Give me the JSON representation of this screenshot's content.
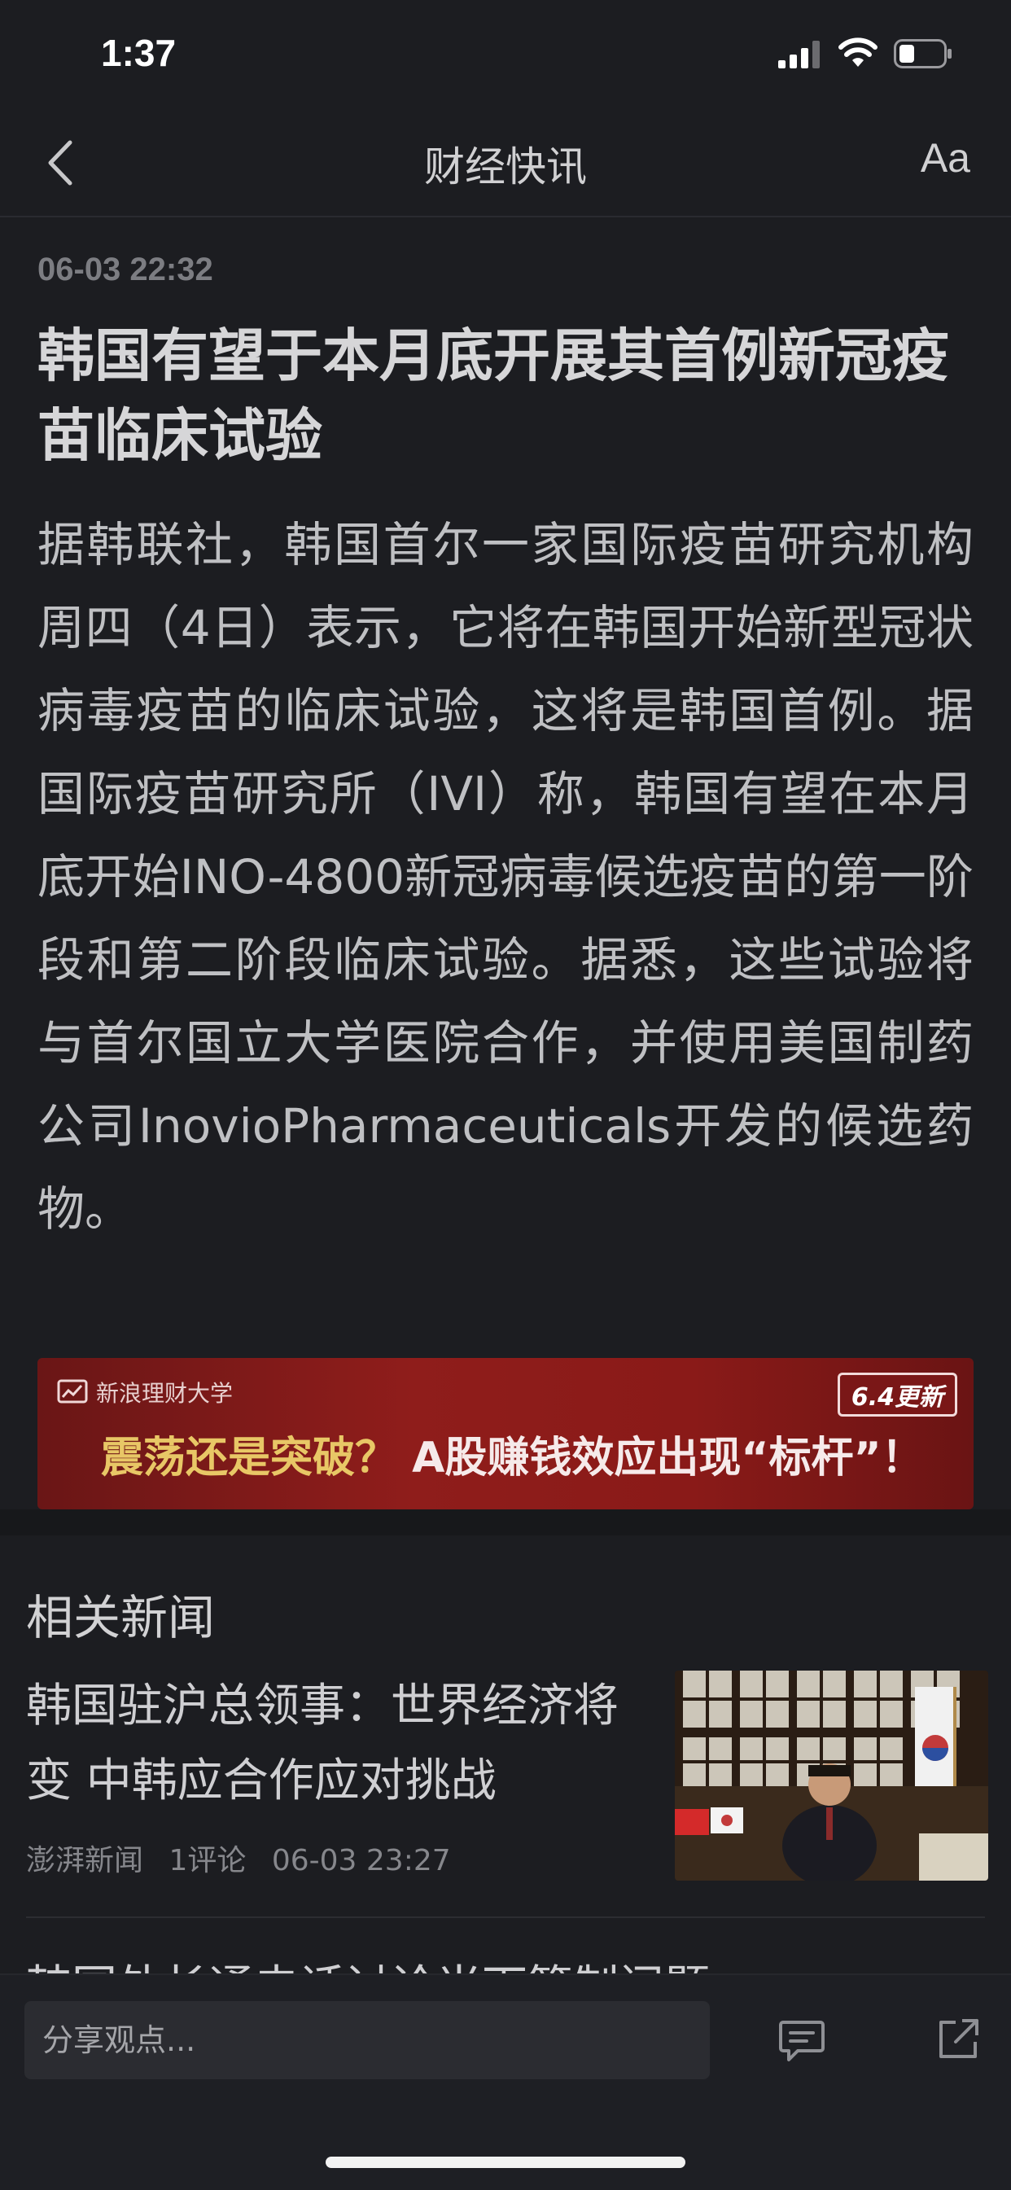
{
  "status_bar": {
    "time": "1:37"
  },
  "nav": {
    "title": "财经快讯",
    "font_size_label": "Aa"
  },
  "article": {
    "time": "06-03 22:32",
    "title": "韩国有望于本月底开展其首例新冠疫苗临床试验",
    "body": "据韩联社，韩国首尔一家国际疫苗研究机构周四（4日）表示，它将在韩国开始新型冠状病毒疫苗的临床试验，这将是韩国首例。据国际疫苗研究所（IVI）称，韩国有望在本月底开始INO-4800新冠病毒候选疫苗的第一阶段和第二阶段临床试验。据悉，这些试验将与首尔国立大学医院合作，并使用美国制药公司InovioPharmaceuticals开发的候选药物。"
  },
  "ad": {
    "brand": "新浪理财大学",
    "badge": "6.4更新",
    "headline_part1": "震荡还是突破？",
    "headline_part2": "A股赚钱效应出现“标杆”！"
  },
  "related": {
    "section_title": "相关新闻",
    "items": [
      {
        "title": "韩国驻沪总领事：世界经济将变 中韩应合作应对挑战",
        "source": "澎湃新闻",
        "comments": "1评论",
        "time": "06-03 23:27"
      }
    ],
    "next_title_partial": "韩国外长通电话讨论当下管制问题"
  },
  "bottom": {
    "comment_placeholder": "分享观点..."
  },
  "colors": {
    "background": "#1c1d21",
    "ad_red": "#8f1d1b",
    "ad_yellow": "#e8c766"
  }
}
